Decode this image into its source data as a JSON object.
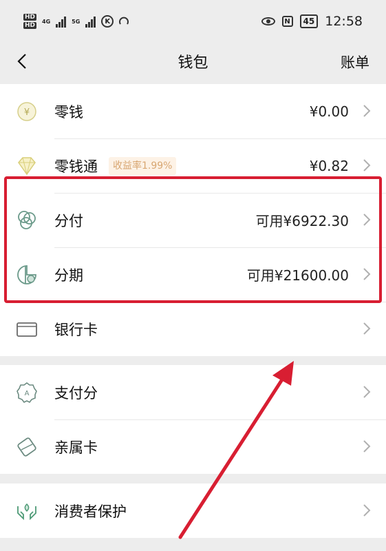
{
  "status_bar": {
    "hd_labels": [
      "HD",
      "HD"
    ],
    "network_labels": [
      "4G",
      "5G"
    ],
    "k_icon_text": "K",
    "nfc_text": "N",
    "battery": "45",
    "time": "12:58"
  },
  "nav": {
    "title": "钱包",
    "right_label": "账单"
  },
  "rows": {
    "change": {
      "label": "零钱",
      "value": "¥0.00",
      "icon": "yuan-coin-icon"
    },
    "lingqiantong": {
      "label": "零钱通",
      "tag": "收益率1.99%",
      "value": "¥0.82",
      "icon": "diamond-icon"
    },
    "fenfu": {
      "label": "分付",
      "value": "可用¥6922.30",
      "icon": "circles-icon"
    },
    "fenqi": {
      "label": "分期",
      "value": "可用¥21600.00",
      "icon": "pie-chart-icon"
    },
    "bank_card": {
      "label": "银行卡",
      "icon": "bank-card-icon"
    },
    "pay_score": {
      "label": "支付分",
      "icon": "badge-icon"
    },
    "family_card": {
      "label": "亲属卡",
      "icon": "family-card-icon"
    },
    "consumer_protection": {
      "label": "消费者保护",
      "icon": "hands-shield-icon"
    }
  },
  "colors": {
    "highlight": "#d81e32",
    "background": "#ededed",
    "tag_text": "#d8a671"
  }
}
